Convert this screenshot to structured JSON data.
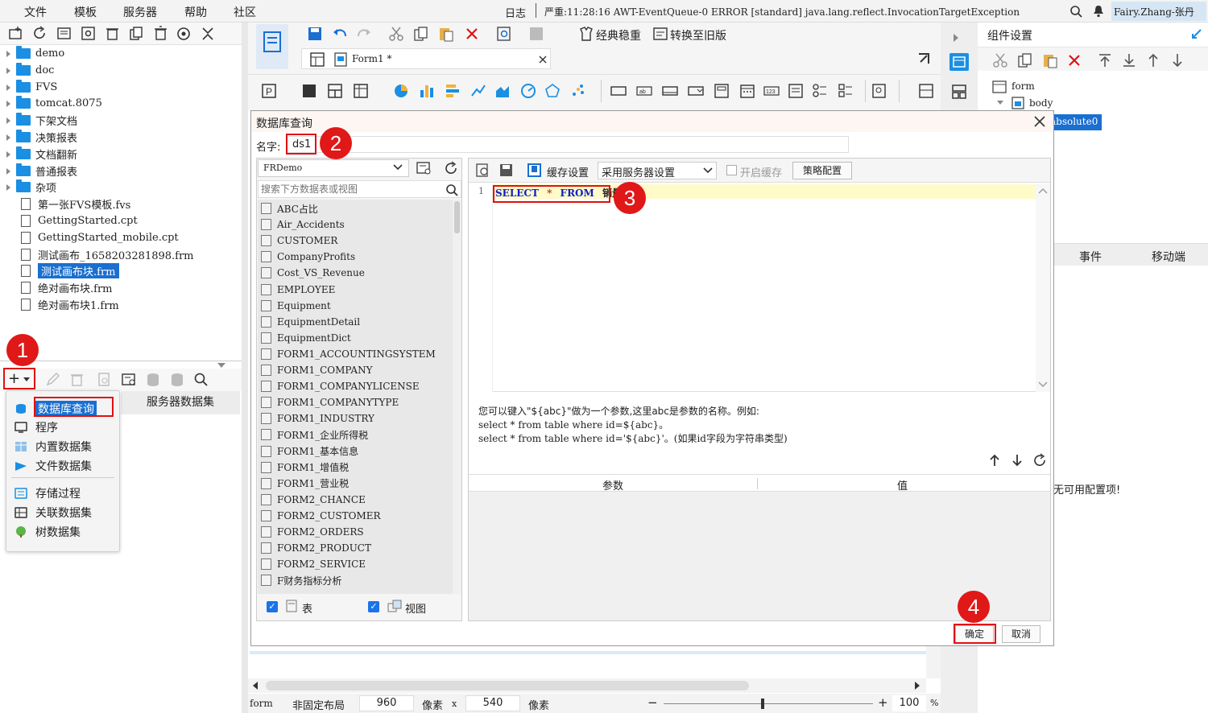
{
  "menubar": {
    "items": [
      "文件",
      "模板",
      "服务器",
      "帮助",
      "社区"
    ],
    "log_label": "日志",
    "log_message": "严重:11:28:16 AWT-EventQueue-0 ERROR [standard] java.lang.reflect.InvocationTargetException",
    "user": "Fairy.Zhang-张丹"
  },
  "file_tree": {
    "items": [
      {
        "label": "demo",
        "type": "folder"
      },
      {
        "label": "doc",
        "type": "folder"
      },
      {
        "label": "FVS",
        "type": "folder"
      },
      {
        "label": "tomcat.8075",
        "type": "folder"
      },
      {
        "label": "下架文档",
        "type": "folder"
      },
      {
        "label": "决策报表",
        "type": "folder"
      },
      {
        "label": "文档翻新",
        "type": "folder"
      },
      {
        "label": "普通报表",
        "type": "folder"
      },
      {
        "label": "杂项",
        "type": "folder"
      },
      {
        "label": "第一张FVS模板.fvs",
        "type": "file"
      },
      {
        "label": "GettingStarted.cpt",
        "type": "file"
      },
      {
        "label": "GettingStarted_mobile.cpt",
        "type": "file"
      },
      {
        "label": "测试画布_1658203281898.frm",
        "type": "file"
      },
      {
        "label": "测试画布块.frm",
        "type": "file",
        "selected": true
      },
      {
        "label": "绝对画布块.frm",
        "type": "file"
      },
      {
        "label": "绝对画布块1.frm",
        "type": "file"
      }
    ]
  },
  "dataset_menu": {
    "add_label": "+",
    "server_dataset_label": "服务器数据集",
    "items": [
      "数据库查询",
      "程序",
      "内置数据集",
      "文件数据集",
      "存储过程",
      "关联数据集",
      "树数据集"
    ]
  },
  "editor": {
    "toolbar": {
      "classic_label": "经典稳重",
      "convert_label": "转换至旧版"
    },
    "tab_label": "Form1 *"
  },
  "right_panel": {
    "title": "组件设置",
    "tree": [
      "form",
      "body",
      "absolute0"
    ],
    "tabs": [
      "事件",
      "移动端"
    ],
    "empty_text": "无可用配置项!"
  },
  "dialog": {
    "title": "数据库查询",
    "name_label": "名字:",
    "name_value": "ds1",
    "connection": "FRDemo",
    "search_placeholder": "搜索下方数据表或视图",
    "tables": [
      "ABC占比",
      "Air_Accidents",
      "CUSTOMER",
      "CompanyProfits",
      "Cost_VS_Revenue",
      "EMPLOYEE",
      "Equipment",
      "EquipmentDetail",
      "EquipmentDict",
      "FORM1_ACCOUNTINGSYSTEM",
      "FORM1_COMPANY",
      "FORM1_COMPANYLICENSE",
      "FORM1_COMPANYTYPE",
      "FORM1_INDUSTRY",
      "FORM1_企业所得税",
      "FORM1_基本信息",
      "FORM1_增值税",
      "FORM1_营业税",
      "FORM2_CHANCE",
      "FORM2_CUSTOMER",
      "FORM2_ORDERS",
      "FORM2_PRODUCT",
      "FORM2_SERVICE",
      "F财务指标分析"
    ],
    "table_check_label": "表",
    "view_check_label": "视图",
    "cache_label": "缓存设置",
    "server_setting": "采用服务器设置",
    "open_cache_label": "开启缓存",
    "strategy_label": "策略配置",
    "sql": {
      "line": "1",
      "keyword1": "SELECT",
      "star": "*",
      "keyword2": "FROM",
      "table": "销量"
    },
    "hint_line1": "您可以键入\"${abc}\"做为一个参数,这里abc是参数的名称。例如:",
    "hint_line2": "select * from table where id=${abc}。",
    "hint_line3": "select * from table where id='${abc}'。(如果id字段为字符串类型)",
    "param_col": "参数",
    "value_col": "值",
    "ok_label": "确定",
    "cancel_label": "取消"
  },
  "statusbar": {
    "form_label": "form",
    "layout_label": "非固定布局",
    "width": "960",
    "px_label1": "像素",
    "x_label": "x",
    "height": "540",
    "px_label2": "像素",
    "minus": "−",
    "plus": "+",
    "zoom": "100",
    "pct": "%"
  },
  "badges": [
    "1",
    "2",
    "3",
    "4"
  ]
}
